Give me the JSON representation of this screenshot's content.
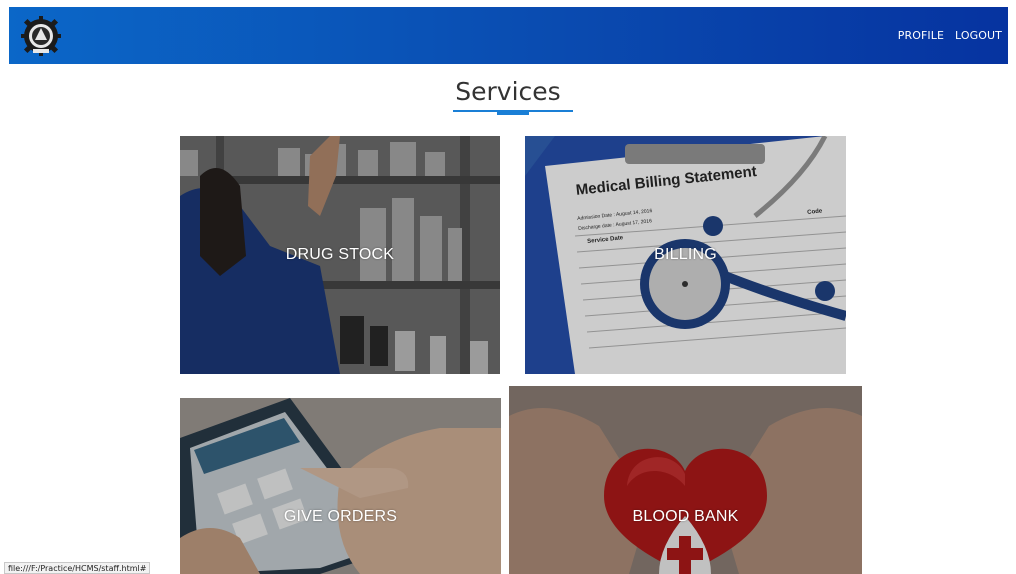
{
  "navbar": {
    "logo_icon": "gear-emblem-icon",
    "links": [
      {
        "label": "PROFILE"
      },
      {
        "label": "LOGOUT"
      }
    ],
    "colors": {
      "start": "#0b67c8",
      "end": "#0633a0"
    }
  },
  "main": {
    "title": "Services",
    "accent_color": "#1a7fd6"
  },
  "services": [
    {
      "label": "DRUG STOCK",
      "image": "pharmacy-shelves-photo"
    },
    {
      "label": "BILLING",
      "image": "medical-billing-statement-photo"
    },
    {
      "label": "GIVE ORDERS",
      "image": "phone-app-photo"
    },
    {
      "label": "BLOOD BANK",
      "image": "heart-in-hands-photo"
    }
  ],
  "billing_document": {
    "heading": "Medical Billing Statement",
    "admission_label": "Admission Date : August 14, 2016",
    "discharge_label": "Discharge date : August 17, 2016",
    "col_service_date": "Service Date",
    "col_code": "Code"
  },
  "status_bar": {
    "url": "file:///F:/Practice/HCMS/staff.html#"
  }
}
